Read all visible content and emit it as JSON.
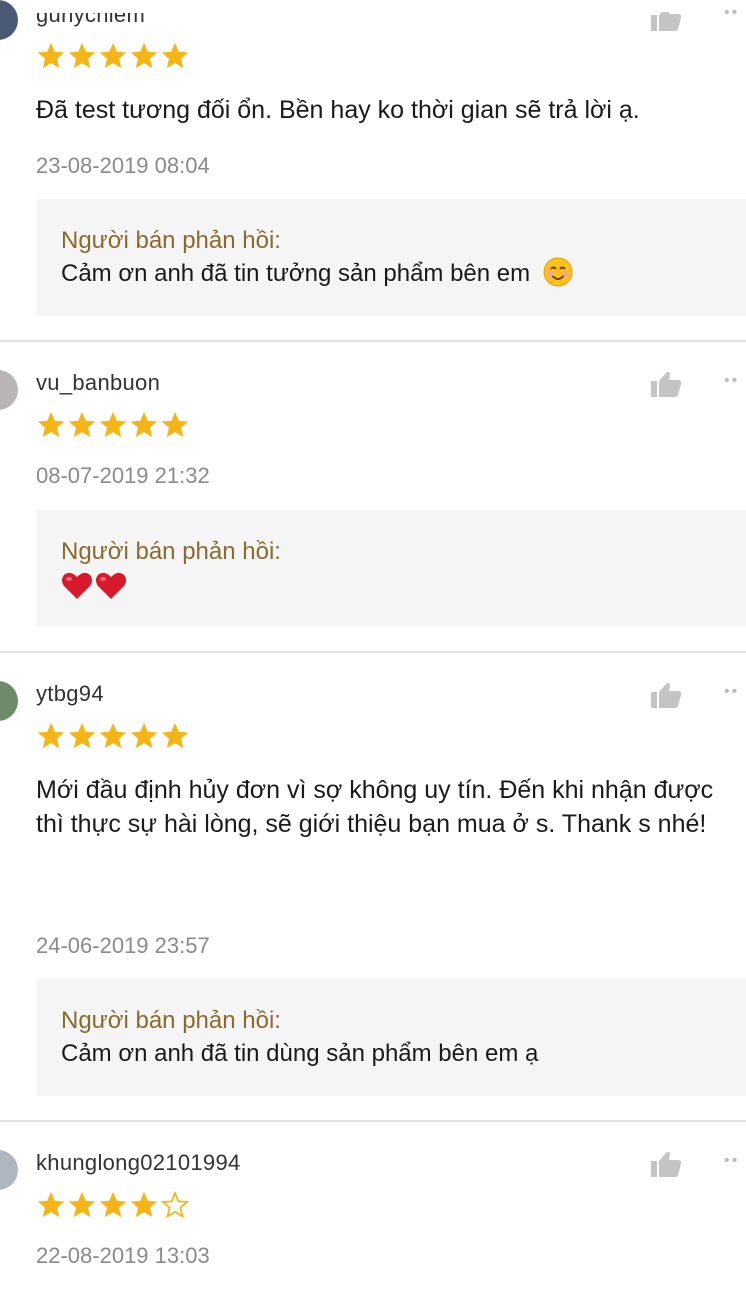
{
  "colors": {
    "star": "#f6b516",
    "reply_label": "#8b6a2b",
    "heart": "#d8182b"
  },
  "reviews": [
    {
      "username": "gunychiem",
      "stars": 5,
      "comment": "Đã test tương đối ổn. Bền hay ko thời gian sẽ trả lời ạ.",
      "timestamp": "23-08-2019 08:04",
      "reply_label": "Người bán phản hồi:",
      "reply_text": "Cảm ơn anh đã tin tưởng sản phẩm bên em"
    },
    {
      "username": "vu_banbuon",
      "stars": 5,
      "timestamp": "08-07-2019 21:32",
      "reply_label": "Người bán phản hồi:",
      "reply_icons": [
        "heart-icon",
        "heart-icon"
      ]
    },
    {
      "username": "ytbg94",
      "stars": 5,
      "comment": "Mới đầu định hủy đơn vì sợ không uy tín. Đến khi nhận được thì thực sự hài lòng, sẽ giới thiệu bạn mua ở s. Thank s nhé!",
      "timestamp": "24-06-2019 23:57",
      "reply_label": "Người bán phản hồi:",
      "reply_text": "Cảm ơn anh đã tin dùng sản phẩm bên em ạ"
    },
    {
      "username": "khunglong02101994",
      "stars": 4,
      "timestamp": "22-08-2019 13:03"
    }
  ]
}
